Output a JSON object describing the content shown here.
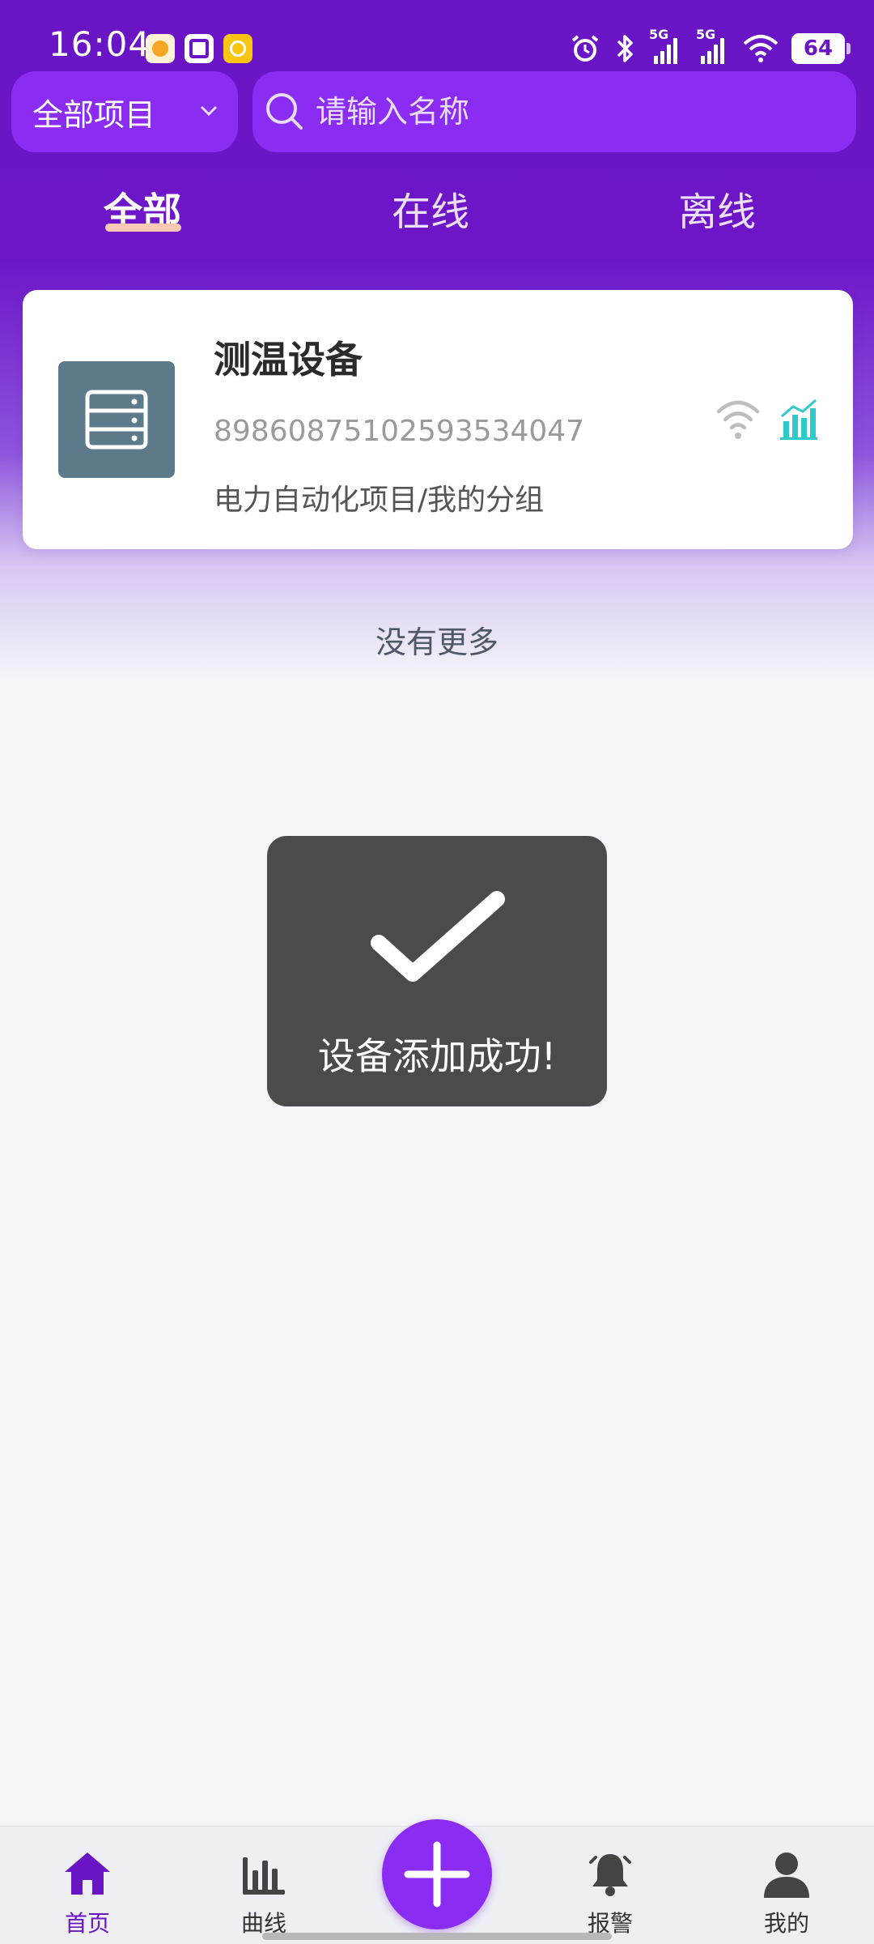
{
  "status_bar": {
    "time": "16:04",
    "battery": "64",
    "network_1": "5G",
    "network_2": "5G"
  },
  "search": {
    "project_filter": "全部项目",
    "placeholder": "请输入名称"
  },
  "tabs": [
    {
      "label": "全部",
      "active": true
    },
    {
      "label": "在线",
      "active": false
    },
    {
      "label": "离线",
      "active": false
    }
  ],
  "devices": [
    {
      "name": "测温设备",
      "id": "89860875102593534047",
      "group": "电力自动化项目/我的分组",
      "status_icon": "wifi-icon",
      "chart_icon": "bar-chart-icon"
    }
  ],
  "list_footer": "没有更多",
  "toast": {
    "icon": "checkmark-icon",
    "message": "设备添加成功!"
  },
  "bottom_nav": [
    {
      "label": "首页",
      "icon": "home-icon",
      "active": true
    },
    {
      "label": "曲线",
      "icon": "bar-chart-icon",
      "active": false
    },
    {
      "label": "",
      "icon": "plus-icon",
      "active": false
    },
    {
      "label": "报警",
      "icon": "bell-icon",
      "active": false
    },
    {
      "label": "我的",
      "icon": "user-icon",
      "active": false
    }
  ],
  "colors": {
    "primary": "#6a15c4",
    "accent": "#8a2cf2",
    "chart_icon": "#2ec9c9",
    "toast_bg": "#4b4b4b"
  }
}
